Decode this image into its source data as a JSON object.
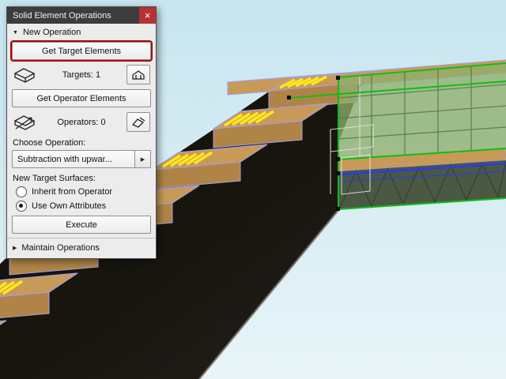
{
  "theme": {
    "sky": "#cfe9f2",
    "wood": "#c79a58",
    "wood_dark": "#b08446",
    "wood_side": "#7d6036",
    "outline": "#a79ede",
    "stripe": "#ffe81a",
    "selection": "#0fbd17",
    "blue": "#2b3fd6",
    "glass": "#8fae6b",
    "titlebar": "#3c3c3c",
    "close": "#b83232",
    "focus": "#b40000",
    "dialog": "#ececec"
  },
  "dialog": {
    "title": "Solid Element Operations",
    "close_icon": "×",
    "new_operation": {
      "icon": "▼",
      "label": "New Operation"
    },
    "get_target": "Get Target Elements",
    "targets": "Targets: 1",
    "get_operator": "Get Operator Elements",
    "operators": "Operators: 0",
    "choose_operation": "Choose Operation:",
    "operation_value": "Subtraction with upwar...",
    "dropdown_arrow": "▶",
    "new_target_surfaces": "New Target Surfaces:",
    "radio_inherit": "Inherit from Operator",
    "radio_own": "Use Own Attributes",
    "execute": "Execute",
    "maintain": {
      "icon": "▶",
      "label": "Maintain Operations"
    }
  }
}
